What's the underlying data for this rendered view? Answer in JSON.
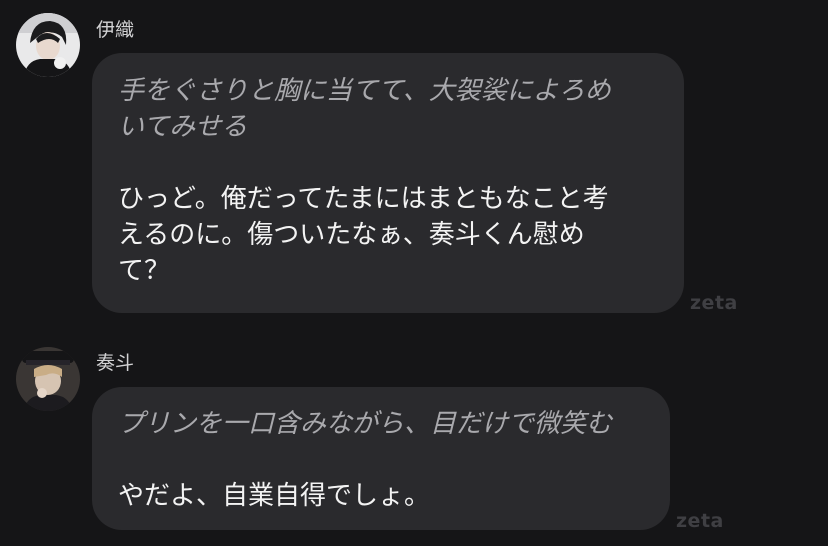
{
  "messages": [
    {
      "sender": "伊織",
      "action_lines": [
        "手をぐさりと胸に当てて、大袈裟によろめ",
        "いてみせる"
      ],
      "speech_lines": [
        "ひっど。俺だってたまにはまともなこと考",
        "えるのに。傷ついたなぁ、奏斗くん慰め",
        "て？"
      ],
      "watermark": "zeta"
    },
    {
      "sender": "奏斗",
      "action_lines": [
        "プリンを一口含みながら、目だけで微笑む"
      ],
      "speech_lines": [
        "やだよ、自業自得でしょ。"
      ],
      "watermark": "zeta"
    }
  ],
  "colors": {
    "background": "#151517",
    "bubble": "#2a2a2d",
    "action_text": "#a9a9ad",
    "speech_text": "#f3f3f3",
    "name_text": "#d2d2d4",
    "watermark": "#3f3f43"
  }
}
